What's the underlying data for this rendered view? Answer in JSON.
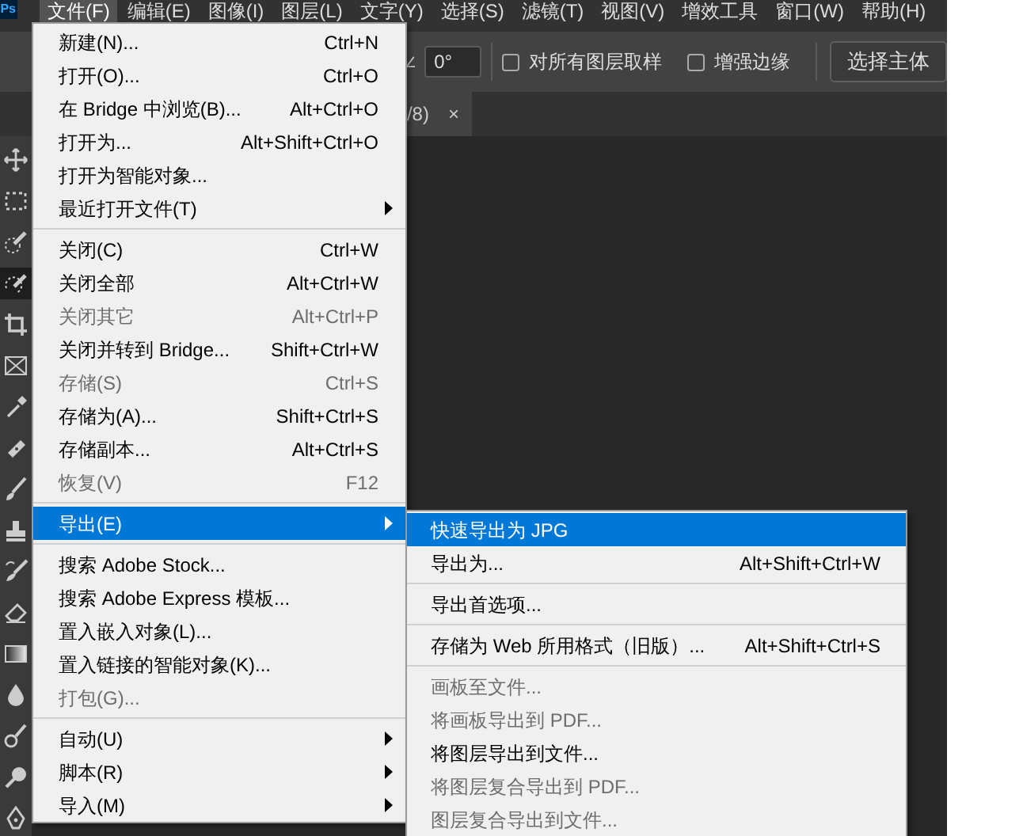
{
  "app_logo": "Ps",
  "menubar": [
    {
      "label": "文件(F)",
      "selected": true
    },
    {
      "label": "编辑(E)",
      "selected": false
    },
    {
      "label": "图像(I)",
      "selected": false
    },
    {
      "label": "图层(L)",
      "selected": false
    },
    {
      "label": "文字(Y)",
      "selected": false
    },
    {
      "label": "选择(S)",
      "selected": false
    },
    {
      "label": "滤镜(T)",
      "selected": false
    },
    {
      "label": "视图(V)",
      "selected": false
    },
    {
      "label": "增效工具",
      "selected": false
    },
    {
      "label": "窗口(W)",
      "selected": false
    },
    {
      "label": "帮助(H)",
      "selected": false
    }
  ],
  "options_bar": {
    "angle_value": "0°",
    "checkboxes": [
      {
        "label": "对所有图层取样",
        "checked": false
      },
      {
        "label": "增强边缘",
        "checked": false
      }
    ],
    "button": "选择主体"
  },
  "document_tab": {
    "title": "/8)",
    "close": "×"
  },
  "toolbar": {
    "tools": [
      {
        "kind": "move",
        "selected": false
      },
      {
        "kind": "marquee",
        "selected": false
      },
      {
        "kind": "quickselect",
        "selected": false
      },
      {
        "kind": "objectselect",
        "selected": true
      },
      {
        "kind": "crop",
        "selected": false
      },
      {
        "kind": "frame",
        "selected": false
      },
      {
        "kind": "eyedropper",
        "selected": false
      },
      {
        "kind": "healing",
        "selected": false
      },
      {
        "kind": "brush",
        "selected": false
      },
      {
        "kind": "stamp",
        "selected": false
      },
      {
        "kind": "historybrush",
        "selected": false
      },
      {
        "kind": "eraser",
        "selected": false
      },
      {
        "kind": "gradient",
        "selected": false
      },
      {
        "kind": "drop",
        "selected": false
      },
      {
        "kind": "smudge",
        "selected": false
      },
      {
        "kind": "dodge",
        "selected": false
      },
      {
        "kind": "pen",
        "selected": false
      }
    ]
  },
  "file_menu": [
    {
      "kind": "item",
      "label": "新建(N)...",
      "shortcut": "Ctrl+N",
      "disabled": false,
      "selected": false,
      "submenu": false
    },
    {
      "kind": "item",
      "label": "打开(O)...",
      "shortcut": "Ctrl+O",
      "disabled": false,
      "selected": false,
      "submenu": false
    },
    {
      "kind": "item",
      "label": "在 Bridge 中浏览(B)...",
      "shortcut": "Alt+Ctrl+O",
      "disabled": false,
      "selected": false,
      "submenu": false
    },
    {
      "kind": "item",
      "label": "打开为...",
      "shortcut": "Alt+Shift+Ctrl+O",
      "disabled": false,
      "selected": false,
      "submenu": false
    },
    {
      "kind": "item",
      "label": "打开为智能对象...",
      "disabled": false,
      "selected": false,
      "submenu": false
    },
    {
      "kind": "item",
      "label": "最近打开文件(T)",
      "disabled": false,
      "selected": false,
      "submenu": true
    },
    {
      "kind": "separator"
    },
    {
      "kind": "item",
      "label": "关闭(C)",
      "shortcut": "Ctrl+W",
      "disabled": false,
      "selected": false,
      "submenu": false
    },
    {
      "kind": "item",
      "label": "关闭全部",
      "shortcut": "Alt+Ctrl+W",
      "disabled": false,
      "selected": false,
      "submenu": false
    },
    {
      "kind": "item",
      "label": "关闭其它",
      "shortcut": "Alt+Ctrl+P",
      "disabled": true,
      "selected": false,
      "submenu": false
    },
    {
      "kind": "item",
      "label": "关闭并转到 Bridge...",
      "shortcut": "Shift+Ctrl+W",
      "disabled": false,
      "selected": false,
      "submenu": false
    },
    {
      "kind": "item",
      "label": "存储(S)",
      "shortcut": "Ctrl+S",
      "disabled": true,
      "selected": false,
      "submenu": false
    },
    {
      "kind": "item",
      "label": "存储为(A)...",
      "shortcut": "Shift+Ctrl+S",
      "disabled": false,
      "selected": false,
      "submenu": false
    },
    {
      "kind": "item",
      "label": "存储副本...",
      "shortcut": "Alt+Ctrl+S",
      "disabled": false,
      "selected": false,
      "submenu": false
    },
    {
      "kind": "item",
      "label": "恢复(V)",
      "shortcut": "F12",
      "disabled": true,
      "selected": false,
      "submenu": false
    },
    {
      "kind": "separator"
    },
    {
      "kind": "item",
      "label": "导出(E)",
      "disabled": false,
      "selected": true,
      "submenu": true
    },
    {
      "kind": "separator"
    },
    {
      "kind": "item",
      "label": "搜索 Adobe Stock...",
      "disabled": false,
      "selected": false,
      "submenu": false
    },
    {
      "kind": "item",
      "label": "搜索 Adobe Express 模板...",
      "disabled": false,
      "selected": false,
      "submenu": false
    },
    {
      "kind": "item",
      "label": "置入嵌入对象(L)...",
      "disabled": false,
      "selected": false,
      "submenu": false
    },
    {
      "kind": "item",
      "label": "置入链接的智能对象(K)...",
      "disabled": false,
      "selected": false,
      "submenu": false
    },
    {
      "kind": "item",
      "label": "打包(G)...",
      "disabled": true,
      "selected": false,
      "submenu": false
    },
    {
      "kind": "separator"
    },
    {
      "kind": "item",
      "label": "自动(U)",
      "disabled": false,
      "selected": false,
      "submenu": true
    },
    {
      "kind": "item",
      "label": "脚本(R)",
      "disabled": false,
      "selected": false,
      "submenu": true
    },
    {
      "kind": "item",
      "label": "导入(M)",
      "disabled": false,
      "selected": false,
      "submenu": true
    }
  ],
  "export_menu": [
    {
      "kind": "item",
      "label": "快速导出为 JPG",
      "disabled": false,
      "selected": true
    },
    {
      "kind": "item",
      "label": "导出为...",
      "shortcut": "Alt+Shift+Ctrl+W",
      "disabled": false,
      "selected": false
    },
    {
      "kind": "separator"
    },
    {
      "kind": "item",
      "label": "导出首选项...",
      "disabled": false,
      "selected": false
    },
    {
      "kind": "separator"
    },
    {
      "kind": "item",
      "label": "存储为 Web 所用格式（旧版）...",
      "shortcut": "Alt+Shift+Ctrl+S",
      "disabled": false,
      "selected": false
    },
    {
      "kind": "separator"
    },
    {
      "kind": "item",
      "label": "画板至文件...",
      "disabled": true,
      "selected": false
    },
    {
      "kind": "item",
      "label": "将画板导出到 PDF...",
      "disabled": true,
      "selected": false
    },
    {
      "kind": "item",
      "label": "将图层导出到文件...",
      "disabled": false,
      "selected": false
    },
    {
      "kind": "item",
      "label": "将图层复合导出到 PDF...",
      "disabled": true,
      "selected": false
    },
    {
      "kind": "item",
      "label": "图层复合导出到文件...",
      "disabled": true,
      "selected": false
    }
  ]
}
